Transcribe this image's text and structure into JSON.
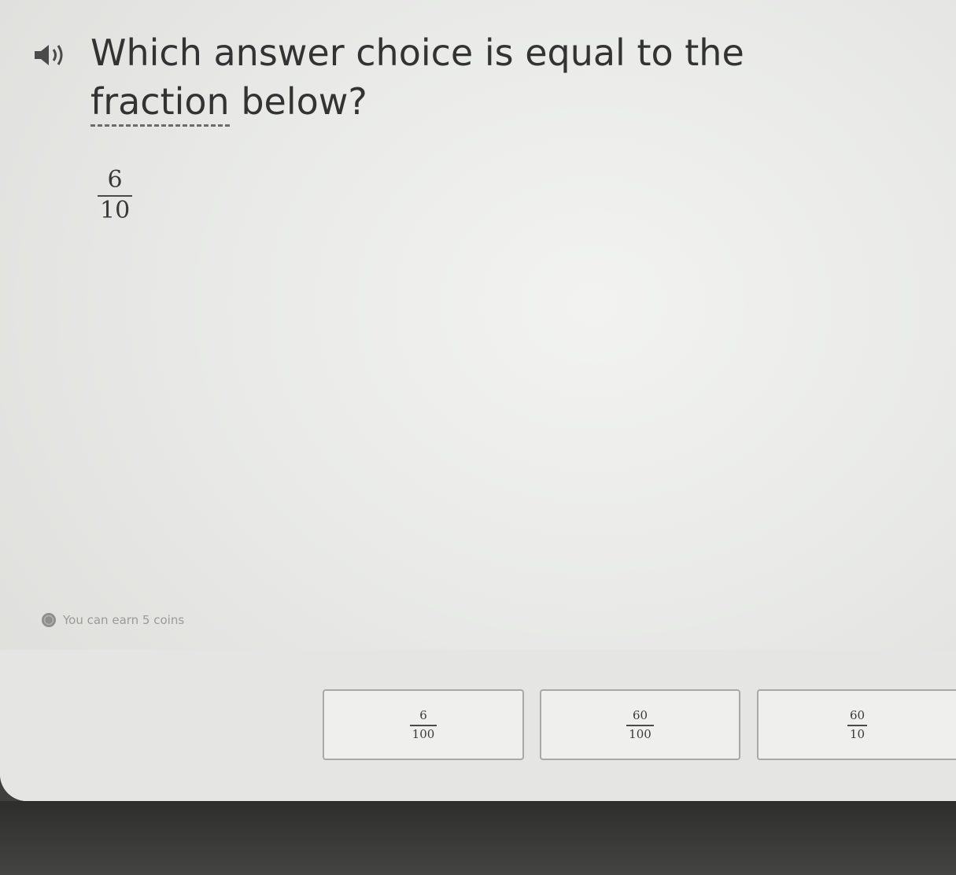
{
  "question": {
    "prompt_before": "Which answer choice is equal to the ",
    "vocab_word": "fraction",
    "prompt_after": " below?",
    "fraction": {
      "numerator": "6",
      "denominator": "10"
    }
  },
  "coins": {
    "text": "You can earn 5 coins"
  },
  "choices": [
    {
      "numerator": "6",
      "denominator": "100"
    },
    {
      "numerator": "60",
      "denominator": "100"
    },
    {
      "numerator": "60",
      "denominator": "10"
    }
  ],
  "icons": {
    "audio": "speaker-icon",
    "coin": "coin-icon"
  },
  "colors": {
    "text": "#333333",
    "background": "#eeefec",
    "choice_border": "#a8a9a6"
  }
}
